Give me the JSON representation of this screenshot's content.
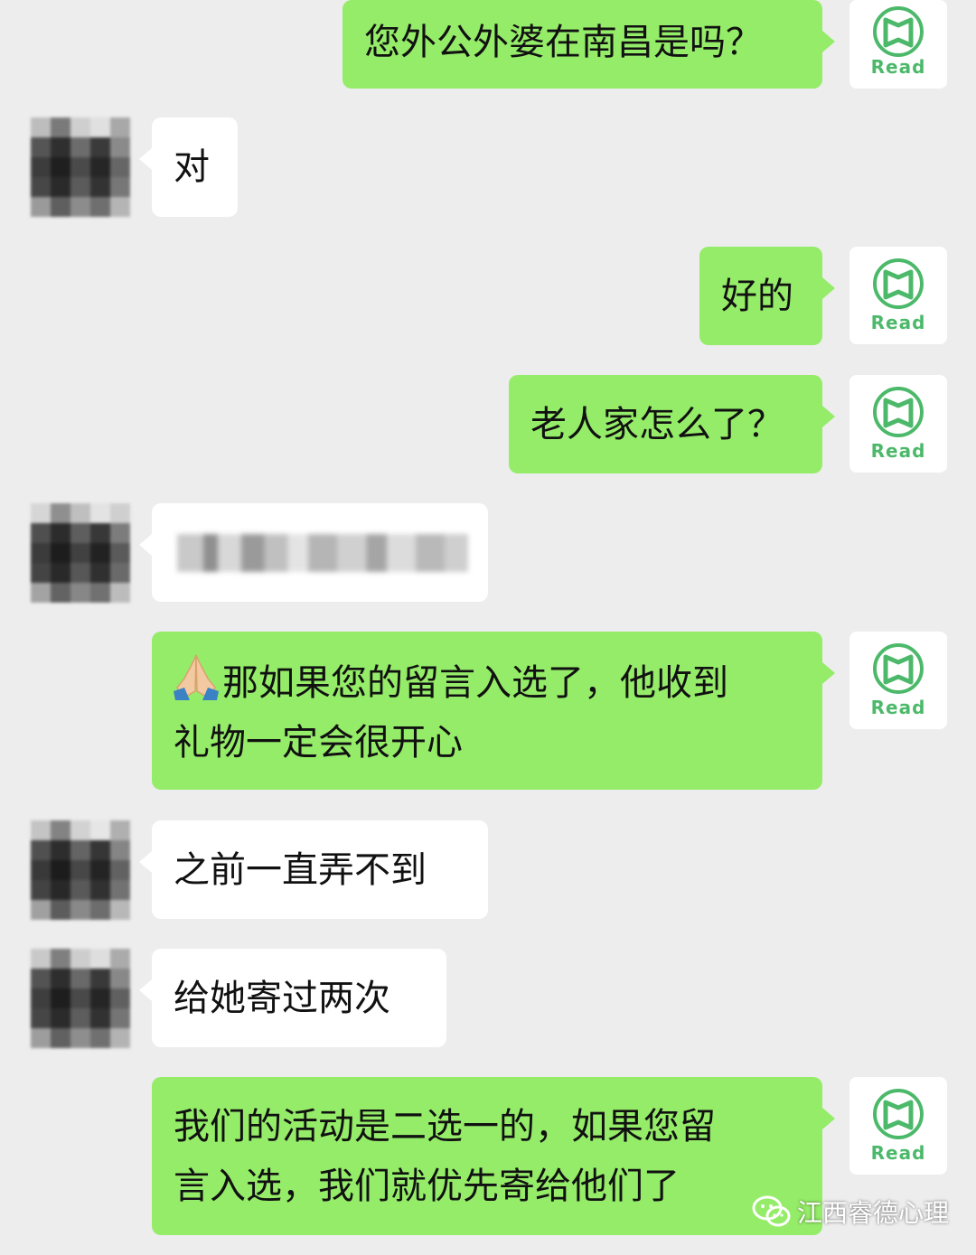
{
  "conversation": {
    "messages": [
      {
        "id": "m1",
        "side": "self",
        "text": "您外公外婆在南昌是吗？"
      },
      {
        "id": "m2",
        "side": "other",
        "text": "对"
      },
      {
        "id": "m3",
        "side": "self",
        "text": "好的"
      },
      {
        "id": "m4",
        "side": "self",
        "text": "老人家怎么了？"
      },
      {
        "id": "m5",
        "side": "other",
        "text": ""
      },
      {
        "id": "m6",
        "side": "self",
        "emoji": "folded-hands",
        "lines": [
          "那如果您的留言入选了，他收到",
          "礼物一定会很开心"
        ]
      },
      {
        "id": "m7",
        "side": "other",
        "text": "之前一直弄不到"
      },
      {
        "id": "m8",
        "side": "other",
        "text": "给她寄过两次"
      },
      {
        "id": "m9",
        "side": "self",
        "lines": [
          "我们的活动是二选一的，如果您留",
          "言入选，我们就优先寄给他们了"
        ]
      }
    ]
  },
  "self_avatar": {
    "label": "Read",
    "icon": "read-logo-icon",
    "color": "#4cb96a"
  },
  "colors": {
    "background": "#ededed",
    "self_bubble": "#95ec69",
    "other_bubble": "#ffffff"
  },
  "watermark": {
    "text": "江西睿德心理",
    "icon": "wechat-icon"
  }
}
